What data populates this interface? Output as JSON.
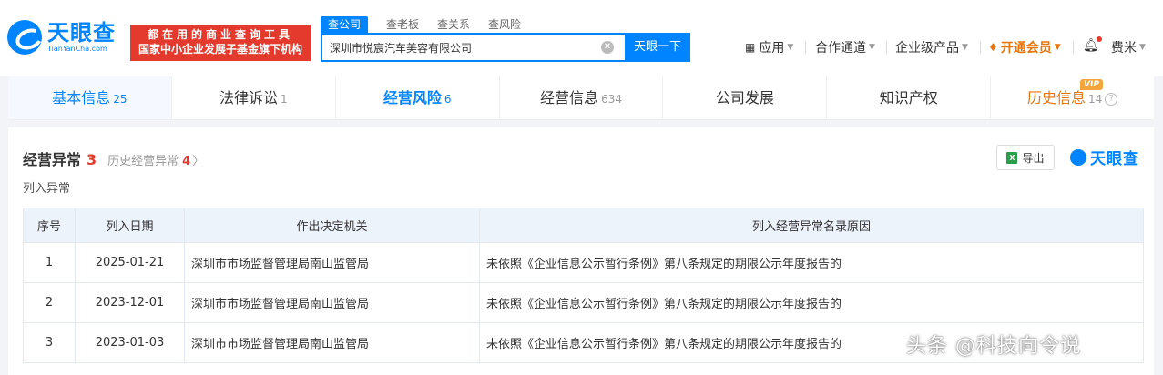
{
  "header": {
    "logo_cn": "天眼查",
    "logo_en": "TianYanCha.com",
    "slogan_line1": "都在用的商业查询工具",
    "slogan_line2": "国家中小企业发展子基金旗下机构",
    "search_tabs": [
      "查公司",
      "查老板",
      "查关系",
      "查风险"
    ],
    "search_value": "深圳市悦宸汽车美容有限公司",
    "search_button": "天眼一下",
    "nav": {
      "app": "应用",
      "channel": "合作通道",
      "enterprise": "企业级产品",
      "vip": "开通会员",
      "user": "费米"
    }
  },
  "tabs": [
    {
      "label": "基本信息",
      "count": "25"
    },
    {
      "label": "法律诉讼",
      "count": "1"
    },
    {
      "label": "经营风险",
      "count": "6"
    },
    {
      "label": "经营信息",
      "count": "634"
    },
    {
      "label": "公司发展",
      "count": ""
    },
    {
      "label": "知识产权",
      "count": ""
    },
    {
      "label": "历史信息",
      "count": "14"
    }
  ],
  "vip_tag": "VIP",
  "section": {
    "title": "经营异常",
    "count": "3",
    "history_label": "历史经营异常",
    "history_count": "4",
    "export_label": "导出",
    "brand": "天眼查",
    "subtitle": "列入异常"
  },
  "table": {
    "headers": [
      "序号",
      "列入日期",
      "作出决定机关",
      "列入经营异常名录原因"
    ],
    "rows": [
      [
        "1",
        "2025-01-21",
        "深圳市市场监督管理局南山监管局",
        "未依照《企业信息公示暂行条例》第八条规定的期限公示年度报告的"
      ],
      [
        "2",
        "2023-12-01",
        "深圳市市场监督管理局南山监管局",
        "未依照《企业信息公示暂行条例》第八条规定的期限公示年度报告的"
      ],
      [
        "3",
        "2023-01-03",
        "深圳市市场监督管理局南山监管局",
        "未依照《企业信息公示暂行条例》第八条规定的期限公示年度报告的"
      ]
    ]
  },
  "watermark": "头条 @科技向令说"
}
